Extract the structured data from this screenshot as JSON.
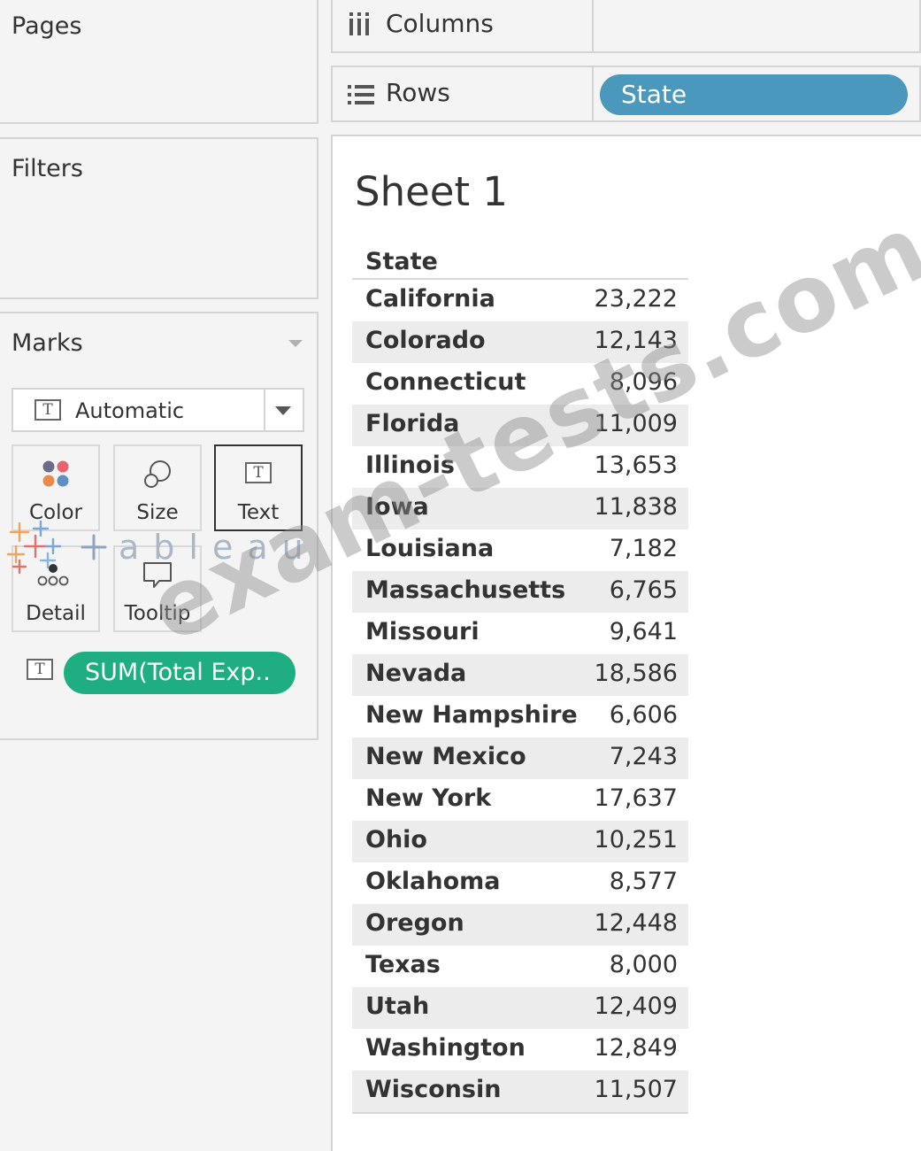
{
  "panels": {
    "pages_label": "Pages",
    "filters_label": "Filters",
    "marks_label": "Marks"
  },
  "marks": {
    "mark_type": "Automatic",
    "buttons": {
      "color": "Color",
      "size": "Size",
      "text": "Text",
      "detail": "Detail",
      "tooltip": "Tooltip"
    },
    "pill": "SUM(Total Exp..",
    "text_icon": "T"
  },
  "shelves": {
    "columns_label": "Columns",
    "rows_label": "Rows",
    "rows_pill": "State"
  },
  "sheet": {
    "title": "Sheet 1",
    "column_header": "State",
    "rows": [
      {
        "state": "California",
        "value": "23,222"
      },
      {
        "state": "Colorado",
        "value": "12,143"
      },
      {
        "state": "Connecticut",
        "value": "8,096"
      },
      {
        "state": "Florida",
        "value": "11,009"
      },
      {
        "state": "Illinois",
        "value": "13,653"
      },
      {
        "state": "Iowa",
        "value": "11,838"
      },
      {
        "state": "Louisiana",
        "value": "7,182"
      },
      {
        "state": "Massachusetts",
        "value": "6,765"
      },
      {
        "state": "Missouri",
        "value": "9,641"
      },
      {
        "state": "Nevada",
        "value": "18,586"
      },
      {
        "state": "New Hampshire",
        "value": "6,606"
      },
      {
        "state": "New Mexico",
        "value": "7,243"
      },
      {
        "state": "New York",
        "value": "17,637"
      },
      {
        "state": "Ohio",
        "value": "10,251"
      },
      {
        "state": "Oklahoma",
        "value": "8,577"
      },
      {
        "state": "Oregon",
        "value": "12,448"
      },
      {
        "state": "Texas",
        "value": "8,000"
      },
      {
        "state": "Utah",
        "value": "12,409"
      },
      {
        "state": "Washington",
        "value": "12,849"
      },
      {
        "state": "Wisconsin",
        "value": "11,507"
      }
    ]
  },
  "overlays": {
    "watermark": "exam-tests.com",
    "tableau_logo": "+ableau"
  },
  "colors": {
    "state_pill": "#4a98bb",
    "measure_pill": "#1fae82",
    "color_dots": [
      "#6b6c8c",
      "#e8636f",
      "#e88a4e",
      "#5e8fc0"
    ]
  }
}
